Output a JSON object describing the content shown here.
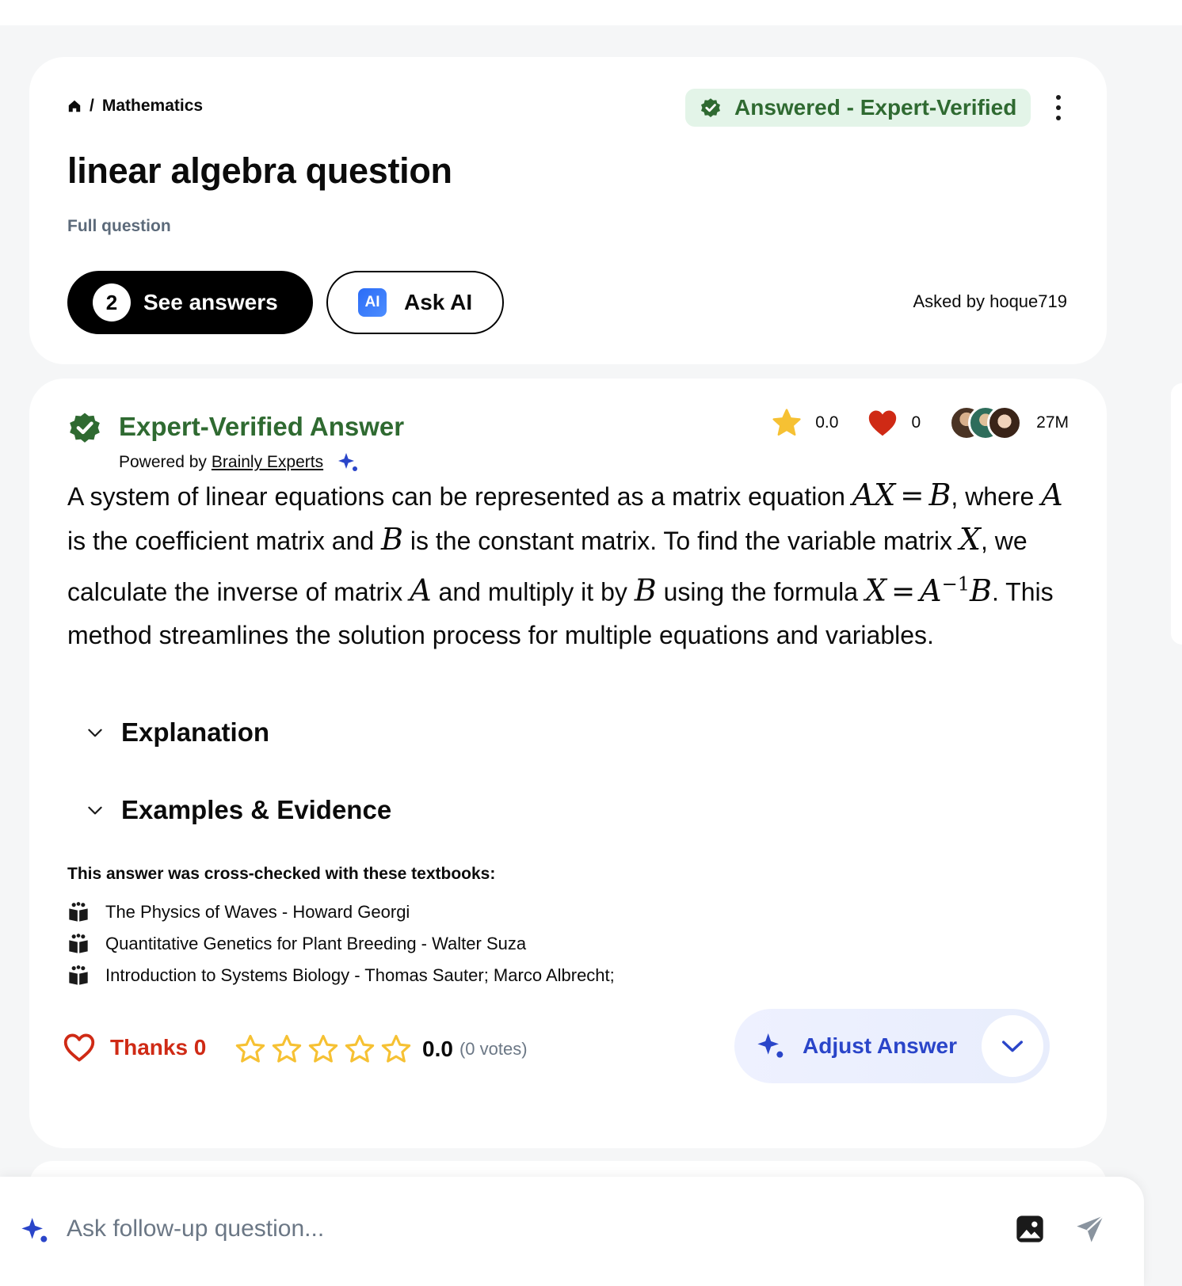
{
  "breadcrumb": {
    "subject": "Mathematics"
  },
  "question": {
    "status": "Answered - Expert-Verified",
    "title": "linear algebra question",
    "full_question_label": "Full question",
    "answers_count": "2",
    "see_answers_label": "See answers",
    "ai_badge": "AI",
    "ask_ai_label": "Ask AI",
    "asked_by": "Asked by hoque719"
  },
  "answer": {
    "badge_title": "Expert-Verified Answer",
    "powered_prefix": "Powered by",
    "powered_link": "Brainly Experts",
    "rating_value": "0.0",
    "likes": "0",
    "views": "27M",
    "body": {
      "t1": "A system of linear equations can be represented as a matrix equation ",
      "m_AX": "AX",
      "op_eq1": "=",
      "m_B1": "B",
      "t2": ", where ",
      "m_A1": "A",
      "t3": " is the coefficient matrix and ",
      "m_B2": "B",
      "t4": " is the constant matrix. To find the variable matrix ",
      "m_X1": "X",
      "t5": ", we calculate the inverse of matrix ",
      "m_A2": "A",
      "t6": " and multiply it by ",
      "m_B3": "B",
      "t7": " using the formula ",
      "m_X2": "X",
      "op_eq2": "=",
      "m_A3": "A",
      "m_sup": "−1",
      "m_B4": "B",
      "t8": ". This method streamlines the solution process for multiple equations and variables."
    },
    "sections": [
      "Explanation",
      "Examples & Evidence"
    ],
    "crosscheck_label": "This answer was cross-checked with these textbooks:",
    "textbooks": [
      "The Physics of Waves - Howard Georgi",
      "Quantitative Genetics for Plant Breeding - Walter Suza",
      "Introduction to Systems Biology - Thomas Sauter; Marco Albrecht;"
    ],
    "thanks_label": "Thanks 0",
    "star_rating": 0,
    "star_rating_max": 5,
    "score": "0.0",
    "votes": "(0 votes)",
    "adjust_label": "Adjust Answer"
  },
  "followup": {
    "placeholder": "Ask follow-up question..."
  },
  "colors": {
    "verified_green": "#2f6a31",
    "thanks_red": "#cf2a15",
    "adjust_blue": "#2a45c9",
    "star_yellow": "#f6c133"
  }
}
